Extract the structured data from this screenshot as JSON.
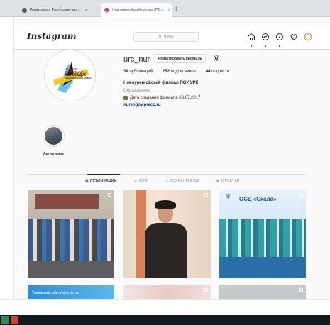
{
  "browser": {
    "tabs": [
      {
        "label": "Редактирую: Расписание зан...",
        "active": false
      },
      {
        "label": "Новоуренгойский филиал ПО...",
        "active": true
      }
    ],
    "new_tab": "+",
    "close_glyph": "×"
  },
  "header": {
    "logo": "Instagram",
    "search_placeholder": "Поиск",
    "nav_icons": [
      "home-icon",
      "messenger-icon",
      "explore-icon",
      "heart-icon",
      "avatar-icon"
    ]
  },
  "profile": {
    "avatar_logo_lines": [
      "УРАЛЬСКИЙ",
      "РЕГИОНАЛЬНЫЙ",
      "КОЛЛЕДЖ",
      "НОВОУРЕНГОЙСКИЙ ФИЛИАЛ"
    ],
    "username": "urc_nur",
    "edit_button": "Редактировать профиль",
    "stats": [
      {
        "count": "39",
        "label": "публикаций"
      },
      {
        "count": "152",
        "label": "подписчиков"
      },
      {
        "count": "44",
        "label": "подписок"
      }
    ],
    "full_name": "Новоуренгойский филиал ПОУ УРК",
    "category": "Образование",
    "created": "Дата создания филиала 03.07.2017",
    "link": "nurengoy.preco.ru"
  },
  "highlight": {
    "label": "Актуальное"
  },
  "profile_tabs": [
    {
      "label": "ПУБЛИКАЦИИ",
      "active": true
    },
    {
      "label": "IGTV",
      "active": false
    },
    {
      "label": "СОХРАНЕННОЕ",
      "active": false
    },
    {
      "label": "ОТМЕТКИ",
      "active": false
    }
  ],
  "posts": {
    "skala_caption": "ОСД «Скала»",
    "banner_text": "Уважаемые абитуриенты и р"
  },
  "colors": {
    "accent": "#0095f6",
    "link": "#00376b",
    "taskbar": "#101820"
  }
}
